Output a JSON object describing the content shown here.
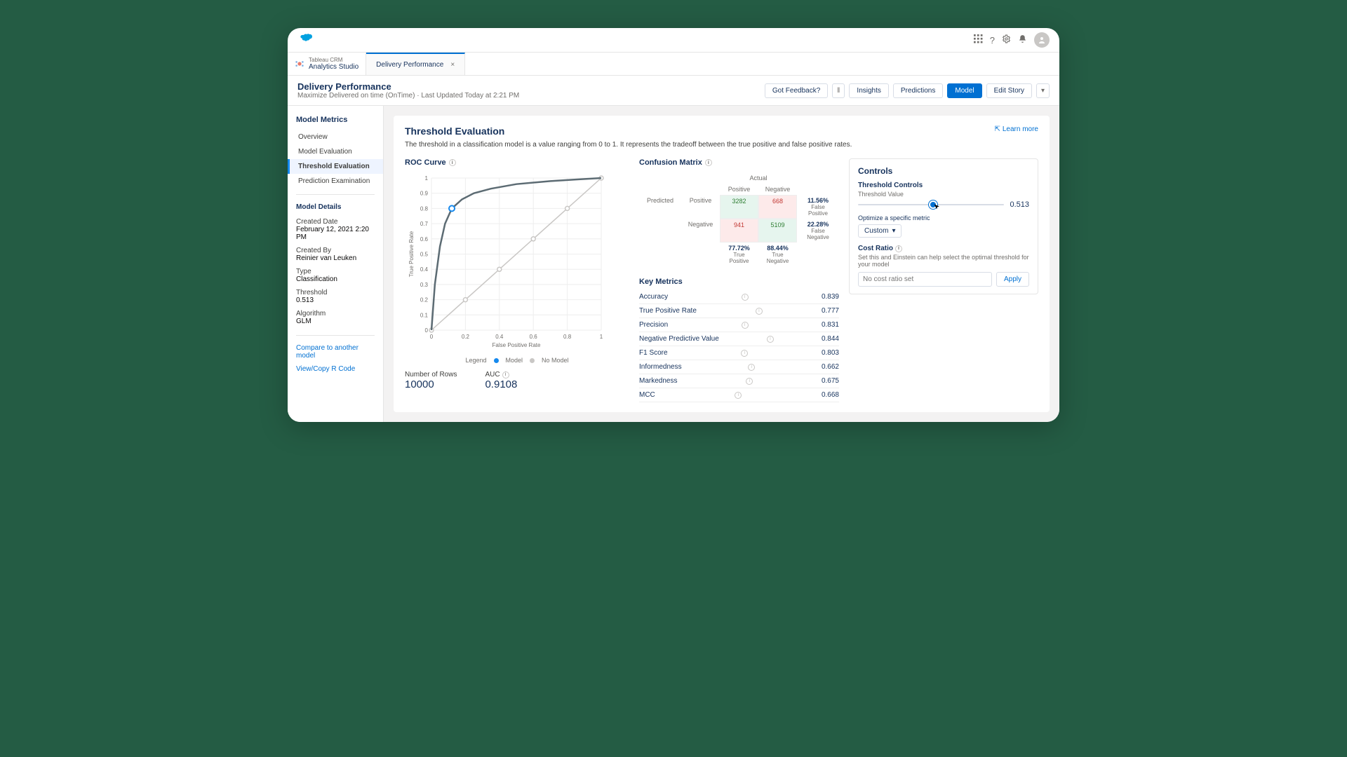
{
  "tabs": {
    "home_line1": "Tableau CRM",
    "home_line2": "Analytics Studio",
    "doc_tab": "Delivery Performance"
  },
  "page": {
    "title": "Delivery Performance",
    "subtitle": "Maximize Delivered on time (OnTime) · Last Updated Today at 2:21 PM"
  },
  "header_actions": {
    "feedback": "Got Feedback?",
    "insights": "Insights",
    "predictions": "Predictions",
    "model": "Model",
    "edit_story": "Edit Story"
  },
  "sidebar": {
    "title": "Model Metrics",
    "items": [
      "Overview",
      "Model Evaluation",
      "Threshold Evaluation",
      "Prediction Examination"
    ],
    "active_index": 2,
    "details_title": "Model Details",
    "created_date_lbl": "Created Date",
    "created_date_val": "February 12, 2021 2:20 PM",
    "created_by_lbl": "Created By",
    "created_by_val": "Reinier van Leuken",
    "type_lbl": "Type",
    "type_val": "Classification",
    "threshold_lbl": "Threshold",
    "threshold_val": "0.513",
    "algo_lbl": "Algorithm",
    "algo_val": "GLM",
    "link_compare": "Compare to another model",
    "link_rcode": "View/Copy R Code"
  },
  "main": {
    "heading": "Threshold Evaluation",
    "learn_more": "Learn more",
    "description": "The threshold in a classification model is a value ranging from 0 to 1. It represents the tradeoff between the true positive and false positive rates.",
    "roc_title": "ROC Curve",
    "legend_label": "Legend",
    "legend_model": "Model",
    "legend_nomodel": "No Model",
    "stats": {
      "rows_lbl": "Number of Rows",
      "rows_val": "10000",
      "auc_lbl": "AUC",
      "auc_val": "0.9108"
    },
    "conf_title": "Confusion Matrix",
    "conf": {
      "actual": "Actual",
      "predicted": "Predicted",
      "pos": "Positive",
      "neg": "Negative",
      "tp": "3282",
      "fn": "668",
      "fp": "941",
      "tn": "5109",
      "fp_rate": "11.56%",
      "fp_rate_lbl": "False Positive",
      "fn_rate": "22.28%",
      "fn_rate_lbl": "False Negative",
      "tpr": "77.72%",
      "tpr_lbl": "True Positive",
      "tnr": "88.44%",
      "tnr_lbl": "True Negative"
    },
    "key_metrics_title": "Key Metrics",
    "key_metrics": [
      {
        "label": "Accuracy",
        "value": "0.839"
      },
      {
        "label": "True Positive Rate",
        "value": "0.777"
      },
      {
        "label": "Precision",
        "value": "0.831"
      },
      {
        "label": "Negative Predictive Value",
        "value": "0.844"
      },
      {
        "label": "F1 Score",
        "value": "0.803"
      },
      {
        "label": "Informedness",
        "value": "0.662"
      },
      {
        "label": "Markedness",
        "value": "0.675"
      },
      {
        "label": "MCC",
        "value": "0.668"
      }
    ],
    "controls": {
      "title": "Controls",
      "threshold_controls": "Threshold Controls",
      "threshold_value_lbl": "Threshold Value",
      "threshold_value": "0.513",
      "slider_pct": 51.3,
      "optimize_lbl": "Optimize a specific metric",
      "optimize_value": "Custom",
      "cost_ratio_lbl": "Cost Ratio",
      "cost_help": "Set this and Einstein can help select the optimal threshold for your model",
      "cost_placeholder": "No cost ratio set",
      "apply": "Apply"
    }
  },
  "chart_data": {
    "type": "line",
    "title": "ROC Curve",
    "xlabel": "False Positive Rate",
    "ylabel": "True Positive Rate",
    "xlim": [
      0,
      1
    ],
    "ylim": [
      0,
      1
    ],
    "xticks": [
      0,
      0.2,
      0.4,
      0.6,
      0.8,
      1
    ],
    "yticks": [
      0,
      0.1,
      0.2,
      0.3,
      0.4,
      0.5,
      0.6,
      0.7,
      0.8,
      0.9,
      1
    ],
    "series": [
      {
        "name": "Model",
        "color": "#5c6b73",
        "points": [
          [
            0,
            0
          ],
          [
            0.02,
            0.3
          ],
          [
            0.05,
            0.55
          ],
          [
            0.08,
            0.7
          ],
          [
            0.12,
            0.8
          ],
          [
            0.18,
            0.86
          ],
          [
            0.25,
            0.9
          ],
          [
            0.35,
            0.93
          ],
          [
            0.5,
            0.96
          ],
          [
            0.7,
            0.98
          ],
          [
            0.85,
            0.99
          ],
          [
            1,
            1
          ]
        ]
      },
      {
        "name": "No Model",
        "color": "#c9c7c5",
        "points": [
          [
            0,
            0
          ],
          [
            1,
            1
          ]
        ]
      }
    ],
    "threshold_marker": {
      "fpr": 0.12,
      "tpr": 0.8
    },
    "auc": 0.9108
  }
}
